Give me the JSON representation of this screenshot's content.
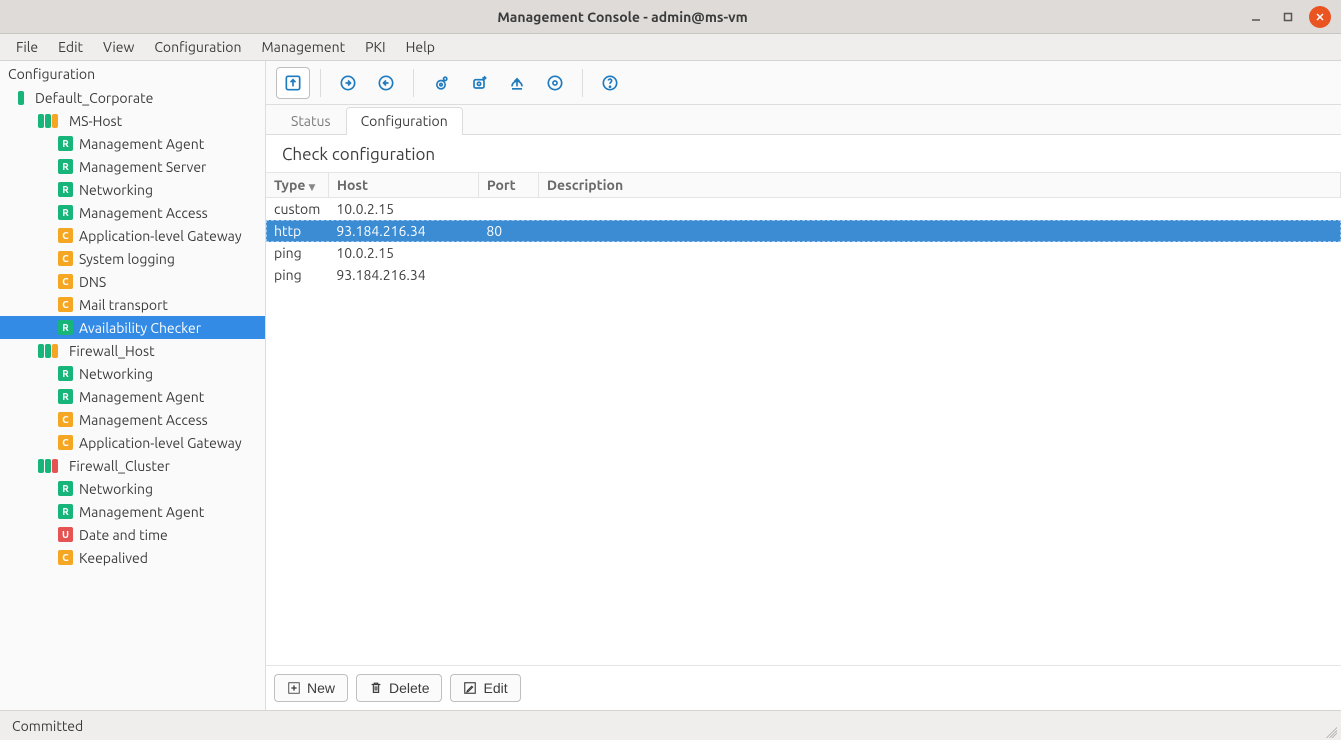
{
  "window": {
    "title": "Management Console - admin@ms-vm"
  },
  "menubar": [
    "File",
    "Edit",
    "View",
    "Configuration",
    "Management",
    "PKI",
    "Help"
  ],
  "sidebar": {
    "heading": "Configuration",
    "tree": [
      {
        "depth": 0,
        "badges": [
          "green"
        ],
        "label": "Default_Corporate"
      },
      {
        "depth": 1,
        "badges": [
          "green",
          "green",
          "orange"
        ],
        "label": "MS-Host"
      },
      {
        "depth": 2,
        "letter": "R",
        "letterColor": "green",
        "label": "Management Agent"
      },
      {
        "depth": 2,
        "letter": "R",
        "letterColor": "green",
        "label": "Management Server"
      },
      {
        "depth": 2,
        "letter": "R",
        "letterColor": "green",
        "label": "Networking"
      },
      {
        "depth": 2,
        "letter": "R",
        "letterColor": "green",
        "label": "Management Access"
      },
      {
        "depth": 2,
        "letter": "C",
        "letterColor": "orange",
        "label": "Application-level Gateway"
      },
      {
        "depth": 2,
        "letter": "C",
        "letterColor": "orange",
        "label": "System logging"
      },
      {
        "depth": 2,
        "letter": "C",
        "letterColor": "orange",
        "label": "DNS"
      },
      {
        "depth": 2,
        "letter": "C",
        "letterColor": "orange",
        "label": "Mail transport"
      },
      {
        "depth": 2,
        "letter": "R",
        "letterColor": "green",
        "label": "Availability Checker",
        "selected": true
      },
      {
        "depth": 1,
        "badges": [
          "green",
          "green",
          "orange"
        ],
        "label": "Firewall_Host"
      },
      {
        "depth": 2,
        "letter": "R",
        "letterColor": "green",
        "label": "Networking"
      },
      {
        "depth": 2,
        "letter": "R",
        "letterColor": "green",
        "label": "Management Agent"
      },
      {
        "depth": 2,
        "letter": "C",
        "letterColor": "orange",
        "label": "Management Access"
      },
      {
        "depth": 2,
        "letter": "C",
        "letterColor": "orange",
        "label": "Application-level Gateway"
      },
      {
        "depth": 1,
        "badges": [
          "green",
          "green",
          "red"
        ],
        "label": "Firewall_Cluster"
      },
      {
        "depth": 2,
        "letter": "R",
        "letterColor": "green",
        "label": "Networking"
      },
      {
        "depth": 2,
        "letter": "R",
        "letterColor": "green",
        "label": "Management Agent"
      },
      {
        "depth": 2,
        "letter": "U",
        "letterColor": "red",
        "label": "Date and time"
      },
      {
        "depth": 2,
        "letter": "C",
        "letterColor": "orange",
        "label": "Keepalived"
      }
    ]
  },
  "tabs": {
    "items": [
      {
        "label": "Status",
        "active": false
      },
      {
        "label": "Configuration",
        "active": true
      }
    ]
  },
  "panel": {
    "heading": "Check configuration"
  },
  "table": {
    "columns": [
      "Type",
      "Host",
      "Port",
      "Description"
    ],
    "sortCol": 0,
    "rows": [
      {
        "cells": [
          "custom",
          "10.0.2.15",
          "",
          ""
        ]
      },
      {
        "cells": [
          "http",
          "93.184.216.34",
          "80",
          ""
        ],
        "selected": true
      },
      {
        "cells": [
          "ping",
          "10.0.2.15",
          "",
          ""
        ]
      },
      {
        "cells": [
          "ping",
          "93.184.216.34",
          "",
          ""
        ]
      }
    ]
  },
  "buttons": {
    "new": "New",
    "delete": "Delete",
    "edit": "Edit"
  },
  "status": {
    "text": "Committed"
  }
}
